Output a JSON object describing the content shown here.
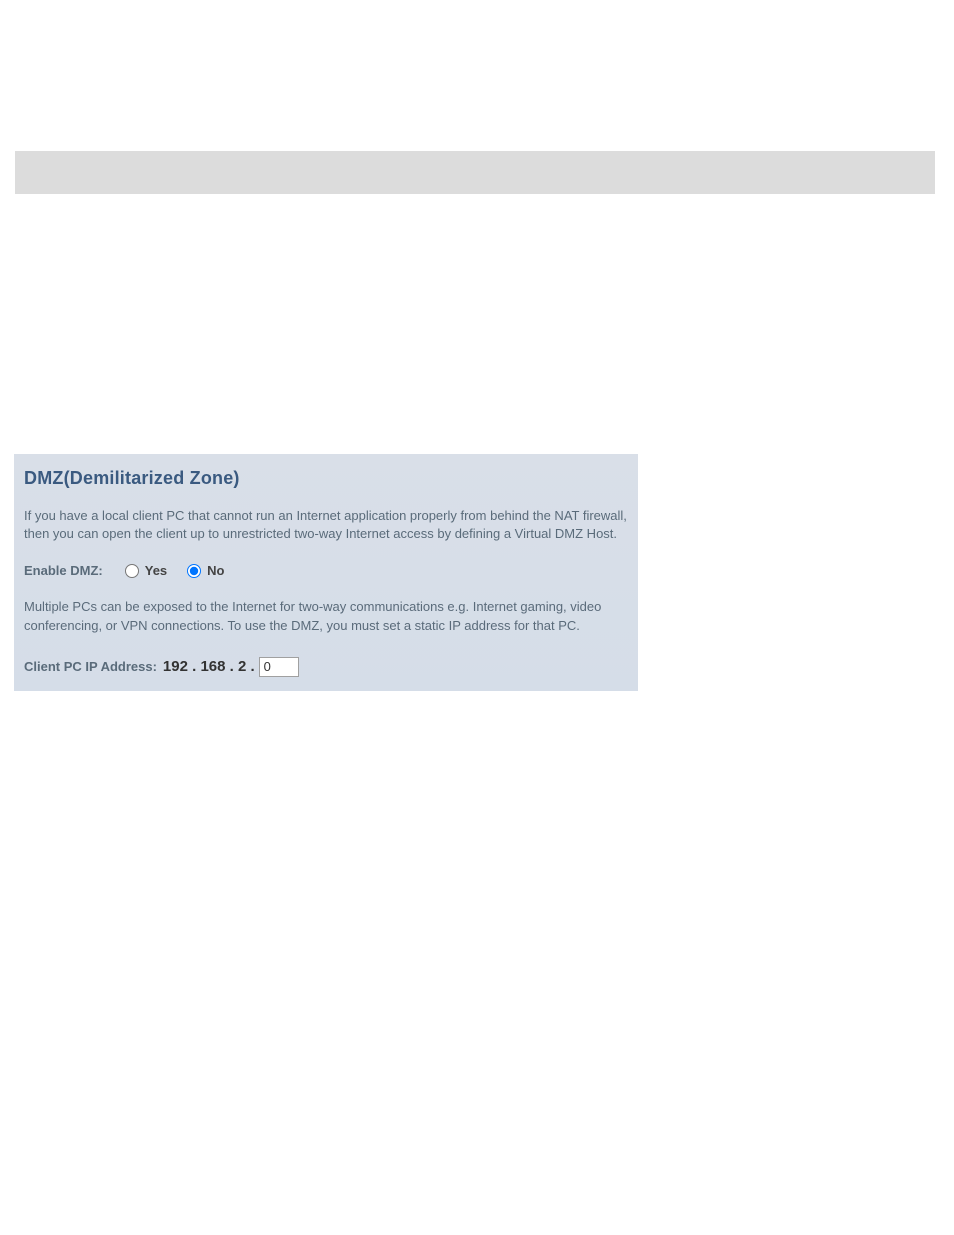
{
  "panel": {
    "title": "DMZ(Demilitarized Zone)",
    "description1": "If you have a local client PC that cannot run an Internet application properly from behind the NAT firewall, then you can open the client up to unrestricted two-way Internet access by defining a Virtual DMZ Host.",
    "enable_label": "Enable DMZ:",
    "radio_yes": "Yes",
    "radio_no": "No",
    "description2": "Multiple PCs can be exposed to the Internet for two-way communications e.g. Internet gaming, video conferencing, or VPN connections.  To use the DMZ, you must set a static IP address for that PC.",
    "ip_label": "Client PC IP Address:",
    "ip_prefix": "192 . 168 . 2 .",
    "ip_value": "0"
  }
}
